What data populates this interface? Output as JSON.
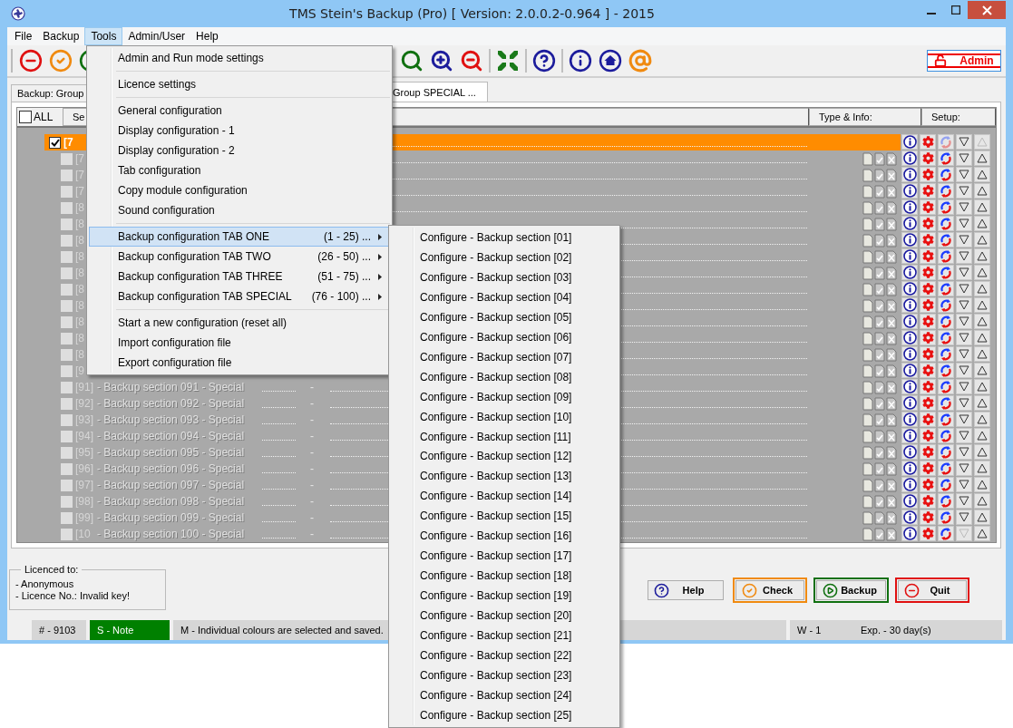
{
  "window": {
    "title": "TMS Stein's Backup (Pro) [ Version: 2.0.0.2-0.964 ] - 2015"
  },
  "menubar": [
    {
      "label": "File",
      "selected": false
    },
    {
      "label": "Backup",
      "selected": false
    },
    {
      "label": "Tools",
      "selected": true
    },
    {
      "label": "Admin/User",
      "selected": false
    },
    {
      "label": "Help",
      "selected": false
    }
  ],
  "toolbar": {
    "admin_button": "Admin"
  },
  "tabs": [
    {
      "label": "Backup: Group",
      "selected": false
    },
    {
      "label": "Group SPECIAL ...",
      "selected": true
    }
  ],
  "grid": {
    "all_label": "ALL",
    "all_checked": false,
    "columns": [
      "Se",
      "Type & Info:",
      "Setup:"
    ],
    "rows": [
      {
        "number": "[7",
        "checked": true,
        "selected": true,
        "sync_enabled": false,
        "up_enabled": false,
        "down_enabled": true
      },
      {
        "number": "[7",
        "checked": false,
        "selected": false,
        "sync_enabled": true,
        "up_enabled": true,
        "down_enabled": true
      },
      {
        "number": "[7",
        "checked": false,
        "selected": false,
        "sync_enabled": true,
        "up_enabled": true,
        "down_enabled": true
      },
      {
        "number": "[7",
        "checked": false,
        "selected": false,
        "sync_enabled": true,
        "up_enabled": true,
        "down_enabled": true
      },
      {
        "number": "[8",
        "checked": false,
        "selected": false,
        "sync_enabled": true,
        "up_enabled": true,
        "down_enabled": true
      },
      {
        "number": "[8",
        "checked": false,
        "selected": false,
        "sync_enabled": true,
        "up_enabled": true,
        "down_enabled": true
      },
      {
        "number": "[8",
        "checked": false,
        "selected": false,
        "sync_enabled": true,
        "up_enabled": true,
        "down_enabled": true
      },
      {
        "number": "[8",
        "checked": false,
        "selected": false,
        "sync_enabled": true,
        "up_enabled": true,
        "down_enabled": true
      },
      {
        "number": "[8",
        "checked": false,
        "selected": false,
        "sync_enabled": true,
        "up_enabled": true,
        "down_enabled": true
      },
      {
        "number": "[8",
        "checked": false,
        "selected": false,
        "sync_enabled": true,
        "up_enabled": true,
        "down_enabled": true
      },
      {
        "number": "[8",
        "checked": false,
        "selected": false,
        "sync_enabled": true,
        "up_enabled": true,
        "down_enabled": true
      },
      {
        "number": "[8",
        "checked": false,
        "selected": false,
        "sync_enabled": true,
        "up_enabled": true,
        "down_enabled": true
      },
      {
        "number": "[8",
        "checked": false,
        "selected": false,
        "sync_enabled": true,
        "up_enabled": true,
        "down_enabled": true
      },
      {
        "number": "[8",
        "checked": false,
        "selected": false,
        "sync_enabled": true,
        "up_enabled": true,
        "down_enabled": true
      },
      {
        "number": "[9",
        "checked": false,
        "selected": false,
        "sync_enabled": true,
        "up_enabled": true,
        "down_enabled": true
      },
      {
        "number": "[91]",
        "name": "- Backup section 091 - Special",
        "dash": "-",
        "checked": false,
        "selected": false,
        "sync_enabled": true,
        "up_enabled": true,
        "down_enabled": true
      },
      {
        "number": "[92]",
        "name": "- Backup section 092 - Special",
        "dash": "-",
        "checked": false,
        "selected": false,
        "sync_enabled": true,
        "up_enabled": true,
        "down_enabled": true
      },
      {
        "number": "[93]",
        "name": "- Backup section 093 - Special",
        "dash": "-",
        "checked": false,
        "selected": false,
        "sync_enabled": true,
        "up_enabled": true,
        "down_enabled": true
      },
      {
        "number": "[94]",
        "name": "- Backup section 094 - Special",
        "dash": "-",
        "checked": false,
        "selected": false,
        "sync_enabled": true,
        "up_enabled": true,
        "down_enabled": true
      },
      {
        "number": "[95]",
        "name": "- Backup section 095 - Special",
        "dash": "-",
        "checked": false,
        "selected": false,
        "sync_enabled": true,
        "up_enabled": true,
        "down_enabled": true
      },
      {
        "number": "[96]",
        "name": "- Backup section 096 - Special",
        "dash": "-",
        "checked": false,
        "selected": false,
        "sync_enabled": true,
        "up_enabled": true,
        "down_enabled": true
      },
      {
        "number": "[97]",
        "name": "- Backup section 097 - Special",
        "dash": "-",
        "checked": false,
        "selected": false,
        "sync_enabled": true,
        "up_enabled": true,
        "down_enabled": true
      },
      {
        "number": "[98]",
        "name": "- Backup section 098 - Special",
        "dash": "-",
        "checked": false,
        "selected": false,
        "sync_enabled": true,
        "up_enabled": true,
        "down_enabled": true
      },
      {
        "number": "[99]",
        "name": "- Backup section 099 - Special",
        "dash": "-",
        "checked": false,
        "selected": false,
        "sync_enabled": true,
        "up_enabled": true,
        "down_enabled": true
      },
      {
        "number": "[10",
        "name": "- Backup section 100 - Special",
        "dash": "-",
        "checked": false,
        "selected": false,
        "sync_enabled": true,
        "up_enabled": true,
        "down_enabled": false
      }
    ]
  },
  "licence": {
    "title": "Licenced to:",
    "lines": [
      "- Anonymous",
      "- Licence No.: Invalid key!"
    ]
  },
  "buttons": [
    {
      "label": "Help",
      "kind": "help"
    },
    {
      "label": "Check",
      "kind": "check"
    },
    {
      "label": "Backup",
      "kind": "backup"
    },
    {
      "label": "Quit",
      "kind": "quit"
    }
  ],
  "status_bar": [
    {
      "kind": "plain",
      "texts": [
        "# - 9103"
      ]
    },
    {
      "kind": "note",
      "texts": [
        "S - Note"
      ]
    },
    {
      "kind": "wide",
      "texts": [
        "M - Individual colours are selected and saved."
      ]
    },
    {
      "kind": "plain",
      "texts": [
        "W - 1",
        "Exp. - 30 day(s)"
      ]
    }
  ],
  "tools_menu": {
    "groups": [
      [
        {
          "label": "Admin and Run mode settings",
          "selected": false
        }
      ],
      [
        {
          "label": "Licence settings",
          "selected": false
        }
      ],
      [
        {
          "label": "General configuration",
          "selected": false
        },
        {
          "label": "Display configuration - 1",
          "selected": false
        },
        {
          "label": "Display configuration - 2",
          "selected": false
        },
        {
          "label": "Tab configuration",
          "selected": false
        },
        {
          "label": "Copy module configuration",
          "selected": false
        },
        {
          "label": "Sound configuration",
          "selected": false
        }
      ],
      [
        {
          "label": "Backup configuration TAB ONE",
          "range": "(1 - 25) ...",
          "submenu": true,
          "selected": true
        },
        {
          "label": "Backup configuration TAB TWO",
          "range": "(26 - 50) ...",
          "submenu": true,
          "selected": false
        },
        {
          "label": "Backup configuration TAB THREE",
          "range": "(51 - 75) ...",
          "submenu": true,
          "selected": false
        },
        {
          "label": "Backup configuration TAB SPECIAL",
          "range": "(76 - 100) ...",
          "submenu": true,
          "selected": false
        }
      ],
      [
        {
          "label": "Start a new configuration (reset all)",
          "selected": false
        },
        {
          "label": "Import configuration file",
          "selected": false
        },
        {
          "label": "Export configuration file",
          "selected": false
        }
      ]
    ]
  },
  "submenu": {
    "items": [
      {
        "label": "Configure - Backup section [01]",
        "selected": false
      },
      {
        "label": "Configure - Backup section [02]",
        "selected": false
      },
      {
        "label": "Configure - Backup section [03]",
        "selected": false
      },
      {
        "label": "Configure - Backup section [04]",
        "selected": false
      },
      {
        "label": "Configure - Backup section [05]",
        "selected": false
      },
      {
        "label": "Configure - Backup section [06]",
        "selected": false
      },
      {
        "label": "Configure - Backup section [07]",
        "selected": false
      },
      {
        "label": "Configure - Backup section [08]",
        "selected": false
      },
      {
        "label": "Configure - Backup section [09]",
        "selected": false
      },
      {
        "label": "Configure - Backup section [10]",
        "selected": false
      },
      {
        "label": "Configure - Backup section [11]",
        "selected": false
      },
      {
        "label": "Configure - Backup section [12]",
        "selected": false
      },
      {
        "label": "Configure - Backup section [13]",
        "selected": false
      },
      {
        "label": "Configure - Backup section [14]",
        "selected": false
      },
      {
        "label": "Configure - Backup section [15]",
        "selected": false
      },
      {
        "label": "Configure - Backup section [16]",
        "selected": false
      },
      {
        "label": "Configure - Backup section [17]",
        "selected": false
      },
      {
        "label": "Configure - Backup section [18]",
        "selected": false
      },
      {
        "label": "Configure - Backup section [19]",
        "selected": false
      },
      {
        "label": "Configure - Backup section [20]",
        "selected": false
      },
      {
        "label": "Configure - Backup section [21]",
        "selected": false
      },
      {
        "label": "Configure - Backup section [22]",
        "selected": false
      },
      {
        "label": "Configure - Backup section [23]",
        "selected": false
      },
      {
        "label": "Configure - Backup section [24]",
        "selected": false
      },
      {
        "label": "Configure - Backup section [25]",
        "selected": false
      }
    ]
  }
}
